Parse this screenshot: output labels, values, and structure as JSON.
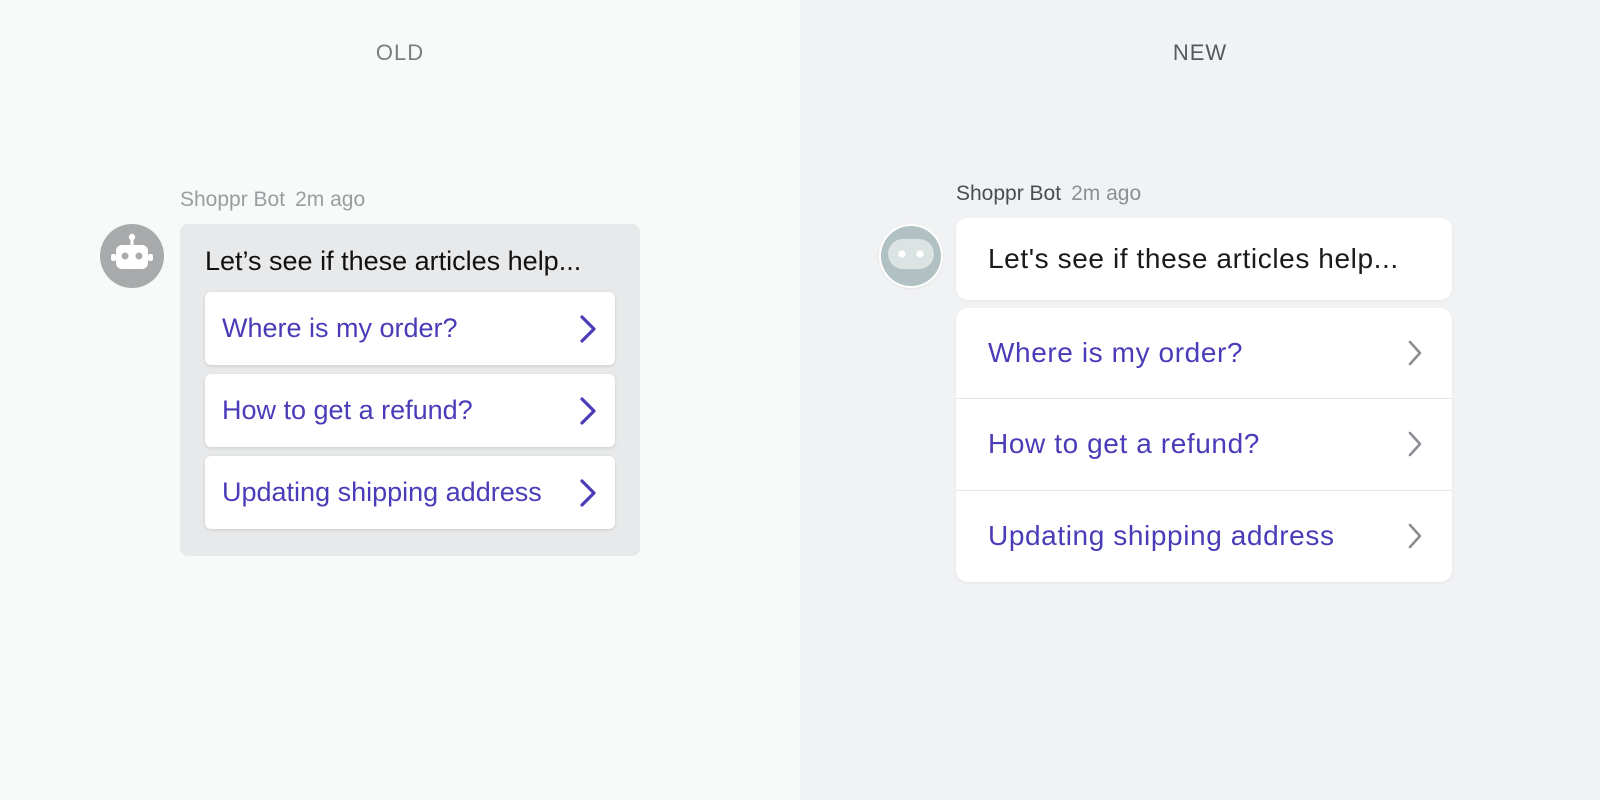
{
  "old": {
    "heading": "OLD",
    "bot_name": "Shoppr Bot",
    "timestamp": "2m ago",
    "intro": "Let’s see if these articles help...",
    "articles": [
      {
        "label": "Where is my order?"
      },
      {
        "label": "How to get a refund?"
      },
      {
        "label": "Updating shipping address"
      }
    ],
    "avatar_icon": "robot-icon",
    "chevron_icon": "chevron-right-icon",
    "colors": {
      "link": "#4a3cb8",
      "bubble": "#e8e9ea",
      "avatar": "#a8aaac"
    }
  },
  "new": {
    "heading": "NEW",
    "bot_name": "Shoppr Bot",
    "timestamp": "2m ago",
    "intro": "Let's see if these articles help...",
    "articles": [
      {
        "label": "Where is my order?"
      },
      {
        "label": "How to get a refund?"
      },
      {
        "label": "Updating shipping address"
      }
    ],
    "avatar_icon": "robot-face-icon",
    "chevron_icon": "chevron-right-icon",
    "colors": {
      "link": "#4a3cb8",
      "card": "#ffffff",
      "avatar": "#b1c0c2",
      "chevron": "#8a8d91"
    }
  }
}
